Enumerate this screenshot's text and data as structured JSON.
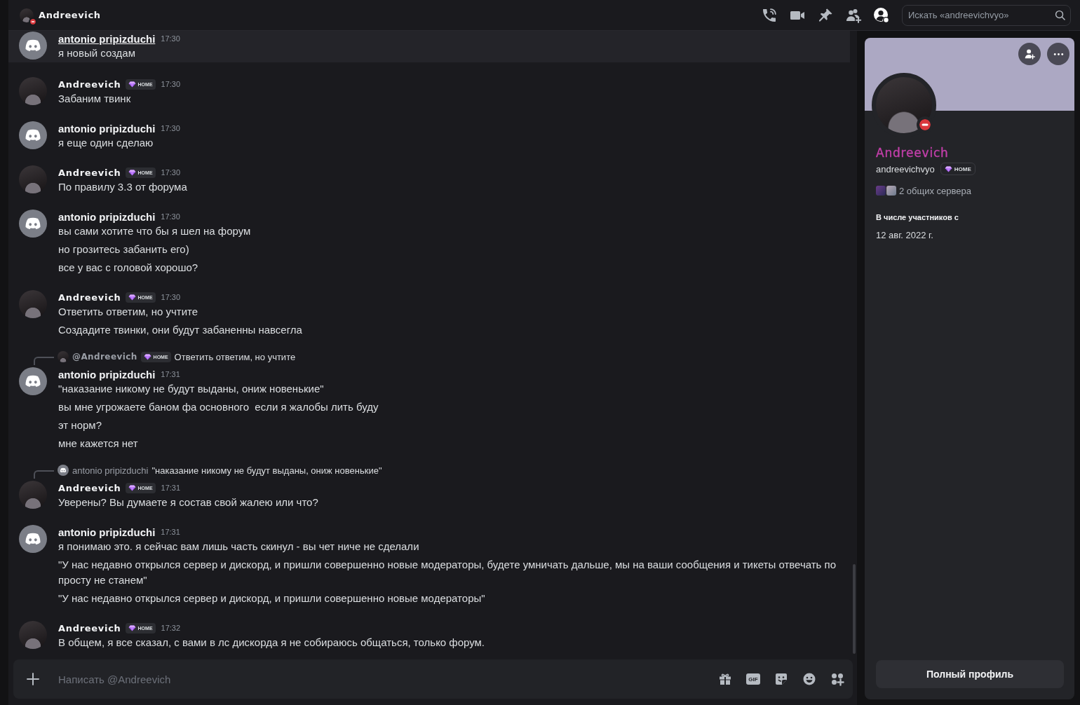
{
  "header": {
    "title": "Andreevich",
    "do_not_disturb": true,
    "toolbar": [
      {
        "kind": "call",
        "selected": false
      },
      {
        "kind": "video",
        "selected": false
      },
      {
        "kind": "pin",
        "selected": false
      },
      {
        "kind": "add-member",
        "selected": false
      },
      {
        "kind": "profile",
        "selected": true
      }
    ],
    "search": {
      "placeholder": "Искать «andreevichvyo»"
    }
  },
  "messages": [
    {
      "kind": "default",
      "author": "antonio pripizduchi",
      "hovered": true,
      "time": "17:30",
      "lines": [
        "я новый создам"
      ]
    },
    {
      "kind": "photo",
      "author": "Andreevich",
      "badge": "HOME",
      "hovered": false,
      "time": "17:30",
      "lines": [
        "Забаним твинк"
      ]
    },
    {
      "kind": "default",
      "author": "antonio pripizduchi",
      "hovered": false,
      "time": "17:30",
      "lines": [
        "я еще один сделаю"
      ]
    },
    {
      "kind": "photo",
      "author": "Andreevich",
      "badge": "HOME",
      "hovered": false,
      "time": "17:30",
      "lines": [
        "По правилу 3.3 от форума"
      ]
    },
    {
      "kind": "default",
      "author": "antonio pripizduchi",
      "hovered": false,
      "time": "17:30",
      "lines": [
        "вы сами хотите что бы я шел на форум",
        "но грозитесь забанить его)",
        "все у вас с головой хорошо?"
      ]
    },
    {
      "kind": "photo",
      "author": "Andreevich",
      "badge": "HOME",
      "hovered": false,
      "time": "17:30",
      "lines": [
        "Ответить ответим, но учтите",
        "Создадите твинки, они будут забаненны навсегла"
      ]
    },
    {
      "kind": "default",
      "reply": {
        "kind": "photo",
        "author": "@Andreevich",
        "badge": "HOME",
        "text": "Ответить ответим, но учтите"
      },
      "author": "antonio pripizduchi",
      "hovered": false,
      "time": "17:31",
      "lines": [
        "\"наказание никому не будут выданы, ониж новенькие\"",
        "вы мне угрожаете баном фа основного  если я жалобы лить буду",
        "эт норм?",
        "мне кажется нет"
      ]
    },
    {
      "kind": "photo",
      "reply": {
        "kind": "default",
        "author": "antonio pripizduchi",
        "text": "\"наказание никому не будут выданы, ониж новенькие\""
      },
      "author": "Andreevich",
      "badge": "HOME",
      "hovered": false,
      "time": "17:31",
      "lines": [
        "Уверены? Вы думаете я состав свой жалею или что?"
      ]
    },
    {
      "kind": "default",
      "author": "antonio pripizduchi",
      "hovered": false,
      "time": "17:31",
      "lines": [
        "я понимаю это. я сейчас вам лишь часть скинул - вы чет ниче не сделали",
        "\"У нас недавно открылся сервер и дискорд, и пришли совершенно новые модераторы, будете умничать дальше, мы на ваши сообщения и тикеты отвечать по просту не станем\"",
        "\"У нас недавно открылся сервер и дискорд, и пришли совершенно новые модераторы\""
      ]
    },
    {
      "kind": "photo",
      "author": "Andreevich",
      "badge": "HOME",
      "hovered": false,
      "time": "17:32",
      "lines": [
        "В общем, я все сказал, с вами в лс дискорда я не собираюсь общаться, только форум."
      ]
    }
  ],
  "composer": {
    "placeholder": "Написать @Andreevich",
    "gif_label": "GIF"
  },
  "profile": {
    "do_not_disturb": true,
    "name": "Andreevich",
    "username": "andreevichvyo",
    "badge": "HOME",
    "mutual_servers": "2 общих сервера",
    "member_since_label": "В числе участников с",
    "member_since": "12 авг. 2022 г.",
    "full_profile_button": "Полный профиль"
  }
}
